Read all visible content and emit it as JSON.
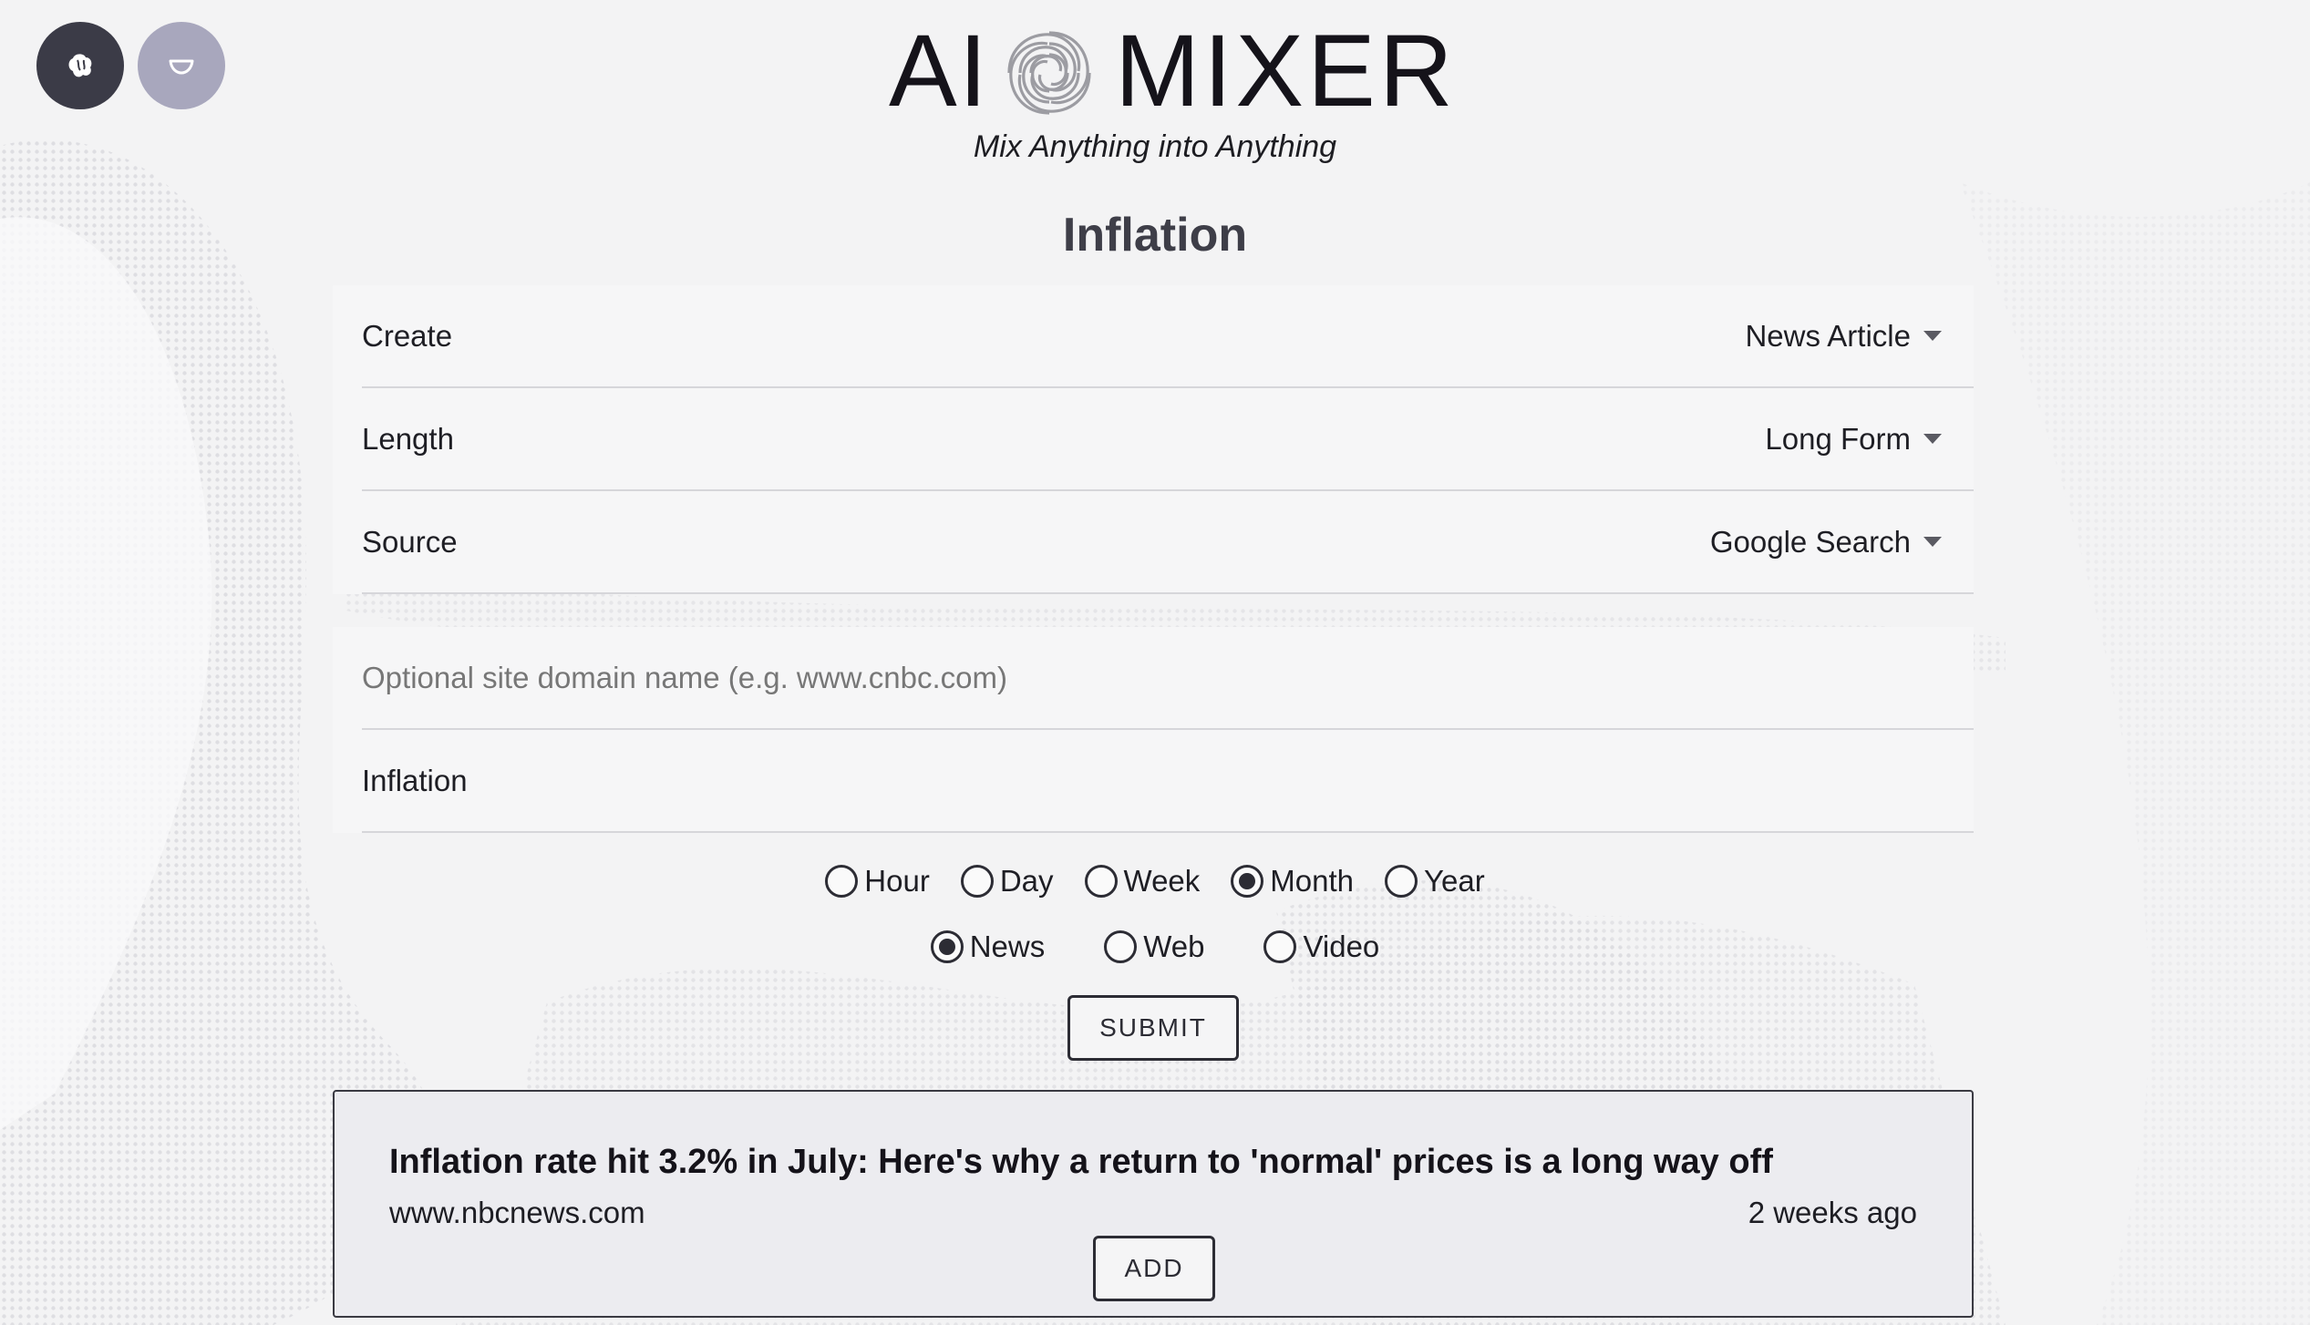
{
  "header": {
    "logo_left": "AI",
    "logo_right": "MIXER",
    "tagline": "Mix Anything into Anything",
    "page_title": "Inflation"
  },
  "form": {
    "create": {
      "label": "Create",
      "value": "News Article"
    },
    "length": {
      "label": "Length",
      "value": "Long Form"
    },
    "source": {
      "label": "Source",
      "value": "Google Search"
    },
    "domain": {
      "placeholder": "Optional site domain name (e.g. www.cnbc.com)",
      "value": ""
    },
    "query": {
      "value": "Inflation"
    }
  },
  "time_range": {
    "options": [
      "Hour",
      "Day",
      "Week",
      "Month",
      "Year"
    ],
    "selected": "Month"
  },
  "search_type": {
    "options": [
      "News",
      "Web",
      "Video"
    ],
    "selected": "News"
  },
  "submit_label": "SUBMIT",
  "result": {
    "title": "Inflation rate hit 3.2% in July: Here's why a return to 'normal' prices is a long way off",
    "source": "www.nbcnews.com",
    "time": "2 weeks ago",
    "add_label": "ADD"
  },
  "icons": {
    "top_left_a": "brain-icon",
    "top_left_b": "bowl-icon",
    "logo_mark": "swirl-icon",
    "dropdown": "caret-down-icon"
  },
  "colors": {
    "dark_button": "#3b3b47",
    "light_button": "#a8a7bd",
    "text": "#15131a"
  }
}
